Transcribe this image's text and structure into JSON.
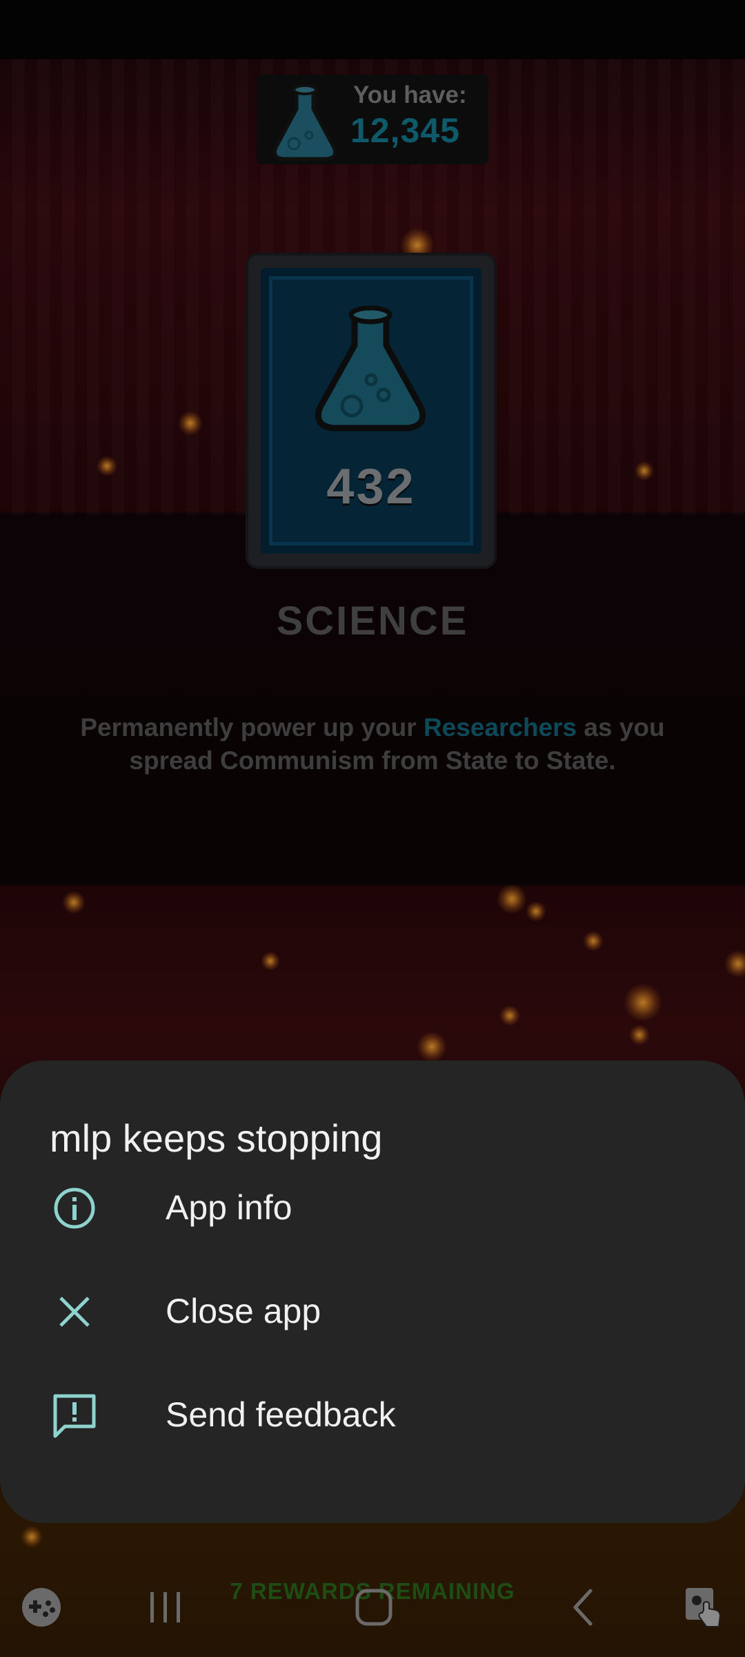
{
  "game": {
    "counter_label": "You have:",
    "counter_value": "12,345",
    "card_value": "432",
    "card_title": "SCIENCE",
    "description": {
      "part1": "Permanently power up your ",
      "highlight": "Researchers",
      "part2": " as you spread Communism from State to State."
    },
    "rewards_label": "7 REWARDS REMAINING"
  },
  "dialog": {
    "title": "mlp keeps stopping",
    "items": [
      {
        "icon": "info-icon",
        "label": "App info"
      },
      {
        "icon": "close-icon",
        "label": "Close app"
      },
      {
        "icon": "feedback-icon",
        "label": "Send feedback"
      }
    ],
    "accent_color": "#8fd3cf"
  },
  "navbar": {
    "buttons": [
      "game-launcher-icon",
      "recent-apps-icon",
      "home-icon",
      "back-icon",
      "screen-touch-icon"
    ]
  }
}
